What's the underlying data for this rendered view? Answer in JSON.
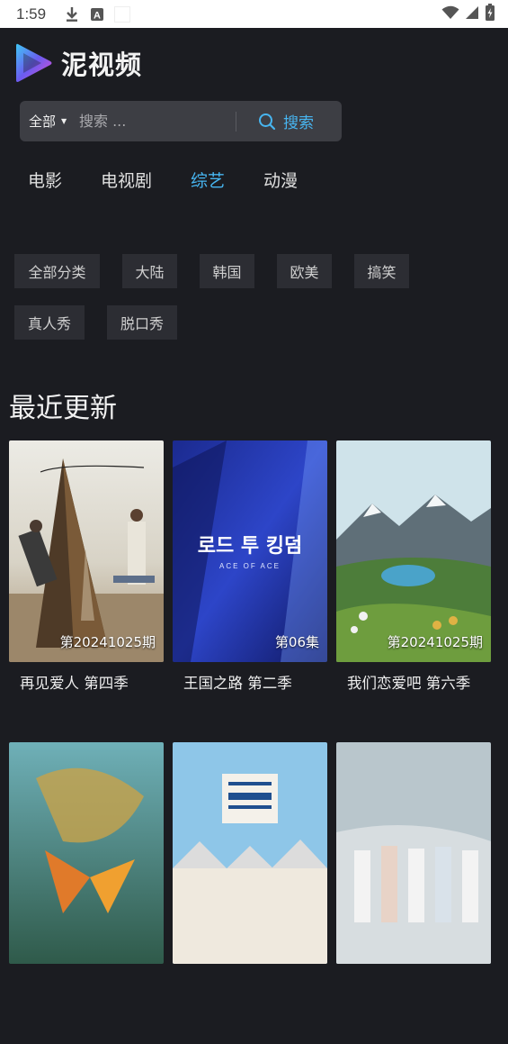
{
  "status_bar": {
    "time": "1:59",
    "icons": [
      "download-icon",
      "font-a-icon",
      "blank-notification-icon",
      "wifi-icon",
      "signal-icon",
      "battery-icon"
    ]
  },
  "app": {
    "title": "泥视频"
  },
  "search": {
    "scope": "全部",
    "placeholder": "搜索 ...",
    "value": "",
    "button_label": "搜索"
  },
  "tabs": [
    {
      "label": "电影",
      "active": false
    },
    {
      "label": "电视剧",
      "active": false
    },
    {
      "label": "综艺",
      "active": true
    },
    {
      "label": "动漫",
      "active": false
    }
  ],
  "filters": [
    "全部分类",
    "大陆",
    "韩国",
    "欧美",
    "搞笑",
    "真人秀",
    "脱口秀"
  ],
  "section": {
    "title": "最近更新"
  },
  "posters_text": {
    "p2_korean": "로드 투 킹덤",
    "p2_english": "ACE OF ACE"
  },
  "items": [
    {
      "title": "再见爱人 第四季",
      "episode": "第20241025期"
    },
    {
      "title": "王国之路 第二季",
      "episode": "第06集"
    },
    {
      "title": "我们恋爱吧 第六季",
      "episode": "第20241025期"
    },
    {
      "title": "",
      "episode": ""
    },
    {
      "title": "",
      "episode": ""
    },
    {
      "title": "",
      "episode": ""
    }
  ],
  "colors": {
    "background": "#1b1c21",
    "accent": "#47b5f0",
    "chip": "#2c2d33",
    "search": "#3d3e44"
  }
}
